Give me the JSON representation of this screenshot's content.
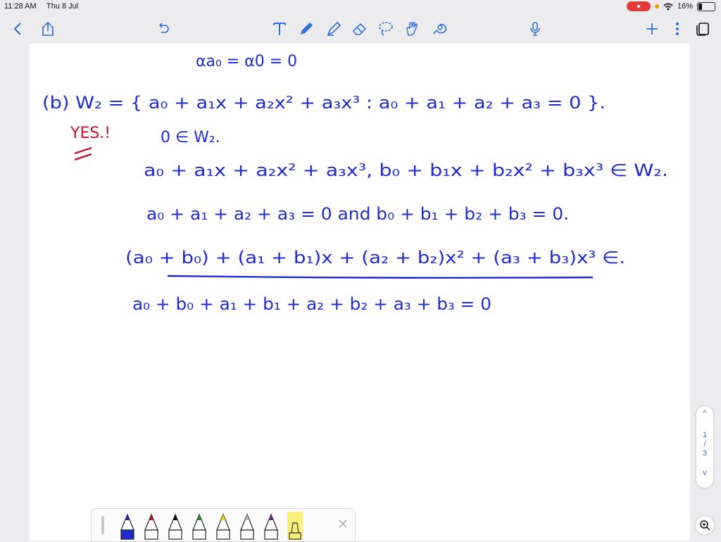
{
  "status_bar": {
    "time": "11:28 AM",
    "date": "Thu 8 Jul",
    "battery": "16%"
  },
  "colors": {
    "ink_blue": "#1f2bd1",
    "ink_red": "#c8102e",
    "toolbar_blue": "#2f6fdf",
    "record_red": "#e03b36"
  },
  "toolbar": {
    "left_icons": [
      "back-chevron-icon",
      "share-icon",
      "undo-icon"
    ],
    "tools": [
      "text-tool-icon",
      "pen-tool-icon",
      "highlighter-tool-icon",
      "eraser-tool-icon",
      "lasso-tool-icon",
      "image-tool-icon",
      "shapes-tool-icon",
      "microphone-icon"
    ],
    "right_icons": [
      "add-page-icon",
      "more-options-icon",
      "pages-overview-icon"
    ]
  },
  "note": {
    "line0": "αa₀ = α0 = 0",
    "line1": "(b) W₂ = { a₀ + a₁x + a₂x² + a₃x³ : a₀ + a₁ + a₂ + a₃ = 0 }.",
    "yes_mark": "YES.!",
    "line2": "0 ∈ W₂.",
    "line3": "a₀ + a₁x + a₂x² + a₃x³,  b₀ + b₁x + b₂x² + b₃x³ ∈ W₂.",
    "line4": "a₀ + a₁ + a₂ + a₃ = 0   and   b₀ + b₁ + b₂ + b₃ = 0.",
    "line5": "(a₀ + b₀) + (a₁ + b₁)x + (a₂ + b₂)x² + (a₃ + b₃)x³ ∈.",
    "line6": "a₀ + b₀ + a₁ + b₁ + a₂ + b₂ + a₃ + b₃ = 0"
  },
  "pager": {
    "up": "^",
    "current": "1",
    "sep": "/",
    "total": "3",
    "down": "v"
  },
  "pen_tray": {
    "pens": [
      {
        "name": "pen-blue",
        "color": "#1f2bd1",
        "selected": true
      },
      {
        "name": "pen-red",
        "color": "#c8102e"
      },
      {
        "name": "pen-black",
        "color": "#111111"
      },
      {
        "name": "pen-green",
        "color": "#1b8a3a"
      },
      {
        "name": "pen-yellow",
        "color": "#f4e200"
      },
      {
        "name": "pen-light",
        "color": "#bbbbbb"
      },
      {
        "name": "pen-purple",
        "color": "#7b1fa2"
      },
      {
        "name": "highlighter-yellow",
        "color": "#f6f07a"
      }
    ]
  }
}
